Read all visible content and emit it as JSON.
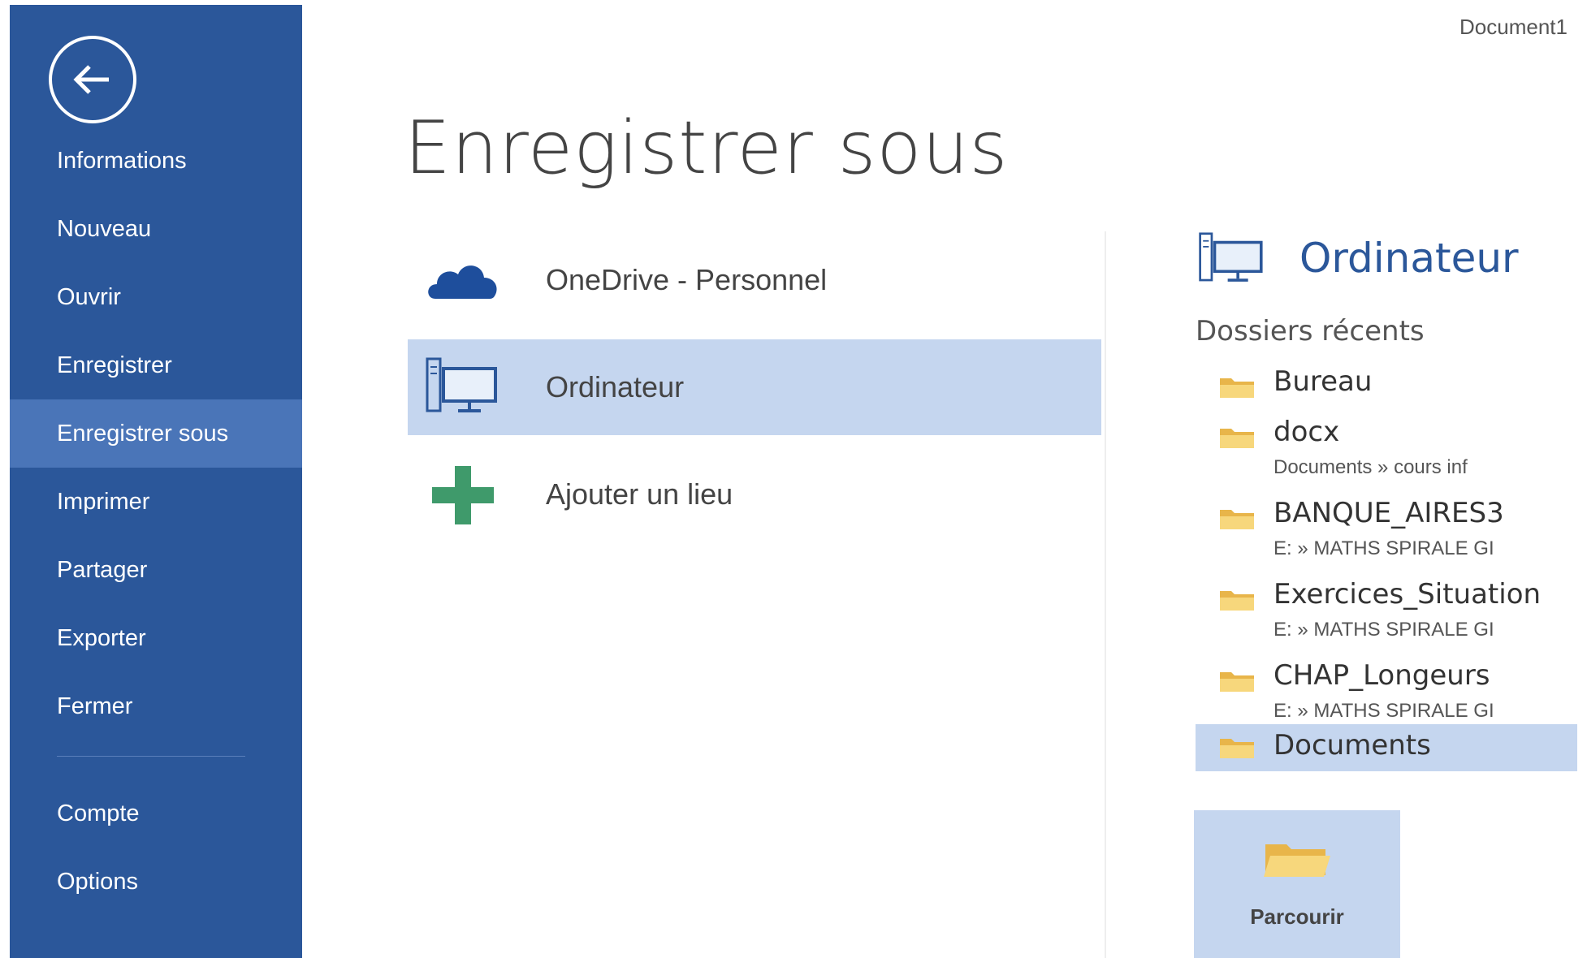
{
  "window": {
    "document_name": "Document1"
  },
  "sidebar": {
    "items": [
      {
        "label": "Informations"
      },
      {
        "label": "Nouveau"
      },
      {
        "label": "Ouvrir"
      },
      {
        "label": "Enregistrer"
      },
      {
        "label": "Enregistrer sous",
        "active": true
      },
      {
        "label": "Imprimer"
      },
      {
        "label": "Partager"
      },
      {
        "label": "Exporter"
      },
      {
        "label": "Fermer"
      }
    ],
    "bottom_items": [
      {
        "label": "Compte"
      },
      {
        "label": "Options"
      }
    ],
    "back_icon": "back-arrow-icon",
    "color": "#2b579a",
    "active_color": "#4a75b8"
  },
  "main": {
    "title": "Enregistrer sous",
    "locations": [
      {
        "label": "OneDrive - Personnel",
        "icon": "cloud-icon"
      },
      {
        "label": "Ordinateur",
        "icon": "computer-icon",
        "active": true
      },
      {
        "label": "Ajouter un lieu",
        "icon": "plus-icon"
      }
    ]
  },
  "right_pane": {
    "title": "Ordinateur",
    "recent_label": "Dossiers récents",
    "folders": [
      {
        "name": "Bureau",
        "path": ""
      },
      {
        "name": "docx",
        "path": "Documents » cours inf"
      },
      {
        "name": "BANQUE_AIRES3",
        "path": "E: » MATHS SPIRALE GI"
      },
      {
        "name": "Exercices_Situation",
        "path": "E: » MATHS SPIRALE GI"
      },
      {
        "name": "CHAP_Longeurs",
        "path": "E: » MATHS SPIRALE GI"
      },
      {
        "name": "Documents",
        "path": "",
        "active": true
      }
    ],
    "browse_label": "Parcourir",
    "accent_color": "#2b579a",
    "selection_color": "#c5d6ef"
  }
}
